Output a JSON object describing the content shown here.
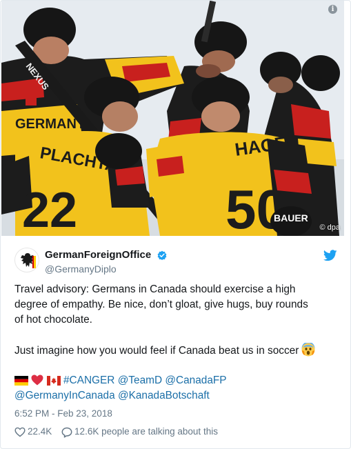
{
  "photo": {
    "credit": "© dpa",
    "jersey_names": [
      "GERMANY",
      "PLACHTA",
      "HAGER"
    ],
    "jersey_numbers": [
      "22",
      "50"
    ],
    "sponsor": "NEXUS",
    "brand_text": "BAUER"
  },
  "tweet": {
    "display_name": "GermanForeignOffice",
    "handle": "@GermanyDiplo",
    "text_line_1": "Travel advisory: Germans in Canada should exercise a high",
    "text_line_2": "degree of empathy. Be nice, don’t gloat, give hugs, buy rounds",
    "text_line_3": "of hot chocolate.",
    "text_line_4": "Just imagine how you would feel if Canada beat us in soccer",
    "hashtag": "#CANGER",
    "mention_1": "@TeamD",
    "mention_2": "@CanadaFP",
    "mention_3": "@GermanyInCanada",
    "mention_4": "@KanadaBotschaft",
    "timestamp": "6:52 PM - Feb 23, 2018",
    "likes": "22.4K",
    "talking": "12.6K people are talking about this"
  },
  "icons": {
    "info": "info-icon",
    "verified": "verified-badge-icon",
    "twitter": "twitter-bird-icon",
    "like": "heart-outline-icon",
    "reply": "speech-bubble-icon",
    "emoji": "screaming-face-emoji"
  },
  "colors": {
    "link": "#1b6fa8",
    "twitter_blue": "#1da1f2",
    "secondary_text": "#657786",
    "jersey_yellow": "#f2c21c",
    "jersey_black": "#1c1c1c",
    "jersey_red": "#c8201e"
  }
}
